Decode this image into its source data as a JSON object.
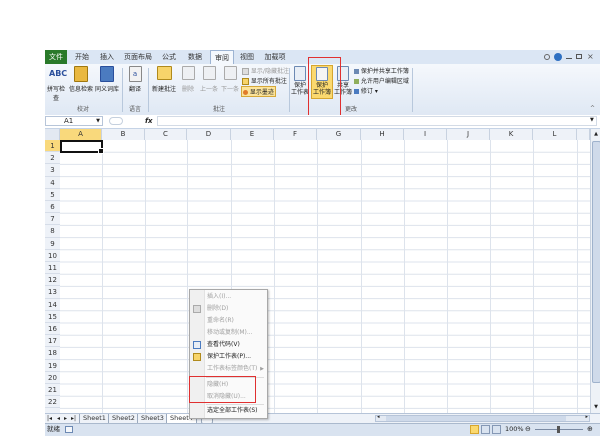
{
  "tabs": [
    "文件",
    "开始",
    "插入",
    "页面布局",
    "公式",
    "数据",
    "审阅",
    "视图",
    "加载项"
  ],
  "active_tab": "审阅",
  "ribbon": {
    "groups": [
      "校对",
      "语言",
      "批注",
      "更改"
    ],
    "proofing": [
      {
        "label": "拼写检查",
        "icon": "spellcheck-icon"
      },
      {
        "label": "信息检索",
        "icon": "research-icon"
      },
      {
        "label": "同义词库",
        "icon": "thesaurus-icon"
      }
    ],
    "language": [
      {
        "label": "翻译",
        "icon": "translate-icon"
      }
    ],
    "comments": [
      {
        "label": "新建批注",
        "icon": "new-comment-icon"
      },
      {
        "label": "删除",
        "icon": "delete-comment-icon"
      },
      {
        "label": "上一条",
        "icon": "previous-comment-icon"
      },
      {
        "label": "下一条",
        "icon": "next-comment-icon"
      }
    ],
    "comments_small": [
      "显示/隐藏批注",
      "显示所有批注",
      "显示墨迹"
    ],
    "changes": [
      {
        "label": "保护\n工作表",
        "icon": "protect-sheet-icon"
      },
      {
        "label": "保护\n工作簿",
        "icon": "protect-workbook-icon"
      },
      {
        "label": "共享\n工作簿",
        "icon": "share-workbook-icon"
      }
    ],
    "changes_small": [
      "保护并共享工作簿",
      "允许用户编辑区域",
      "修订 ▾"
    ]
  },
  "formula_bar": {
    "name_box": "A1",
    "fx": "fx",
    "value": ""
  },
  "columns": [
    "A",
    "B",
    "C",
    "D",
    "E",
    "F",
    "G",
    "H",
    "I",
    "J",
    "K",
    "L"
  ],
  "rows": [
    "1",
    "2",
    "3",
    "4",
    "5",
    "6",
    "7",
    "8",
    "9",
    "10",
    "11",
    "12",
    "13",
    "14",
    "15",
    "16",
    "17",
    "18",
    "19",
    "20",
    "21",
    "22"
  ],
  "selected_cell": "A1",
  "sheet_tabs": [
    "Sheet1",
    "Sheet2",
    "Sheet3",
    "Sheet4"
  ],
  "active_sheet": "Sheet4",
  "status": {
    "mode": "就绪",
    "zoom": "100%"
  },
  "context_menu": [
    {
      "label": "插入(I)...",
      "disabled": true
    },
    {
      "label": "删除(D)",
      "disabled": true,
      "icon": "delete-sheet-icon"
    },
    {
      "label": "重命名(R)",
      "disabled": true
    },
    {
      "label": "移动或复制(M)...",
      "disabled": true
    },
    {
      "label": "查看代码(V)",
      "disabled": false,
      "icon": "view-code-icon"
    },
    {
      "label": "保护工作表(P)...",
      "disabled": false,
      "icon": "protect-sheet-icon"
    },
    {
      "label": "工作表标签颜色(T)",
      "disabled": true,
      "submenu": true
    },
    {
      "label": "隐藏(H)",
      "disabled": true
    },
    {
      "label": "取消隐藏(U)...",
      "disabled": true
    },
    {
      "label": "选定全部工作表(S)",
      "disabled": false
    }
  ],
  "colors": {
    "highlight": "#e03030",
    "selection": "#f9d97c",
    "file_tab": "#2a7a2a"
  }
}
